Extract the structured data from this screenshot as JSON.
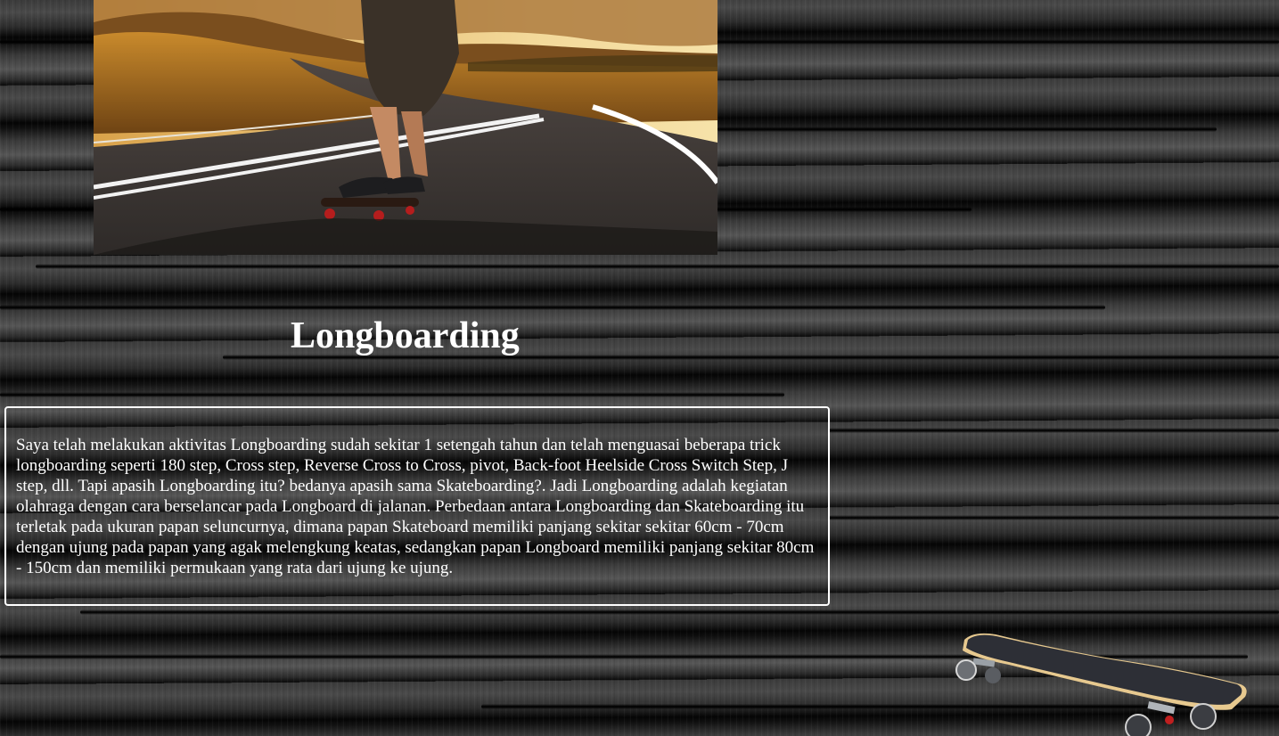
{
  "hero": {
    "icon": "longboarder-road-photo"
  },
  "article": {
    "title": "Longboarding",
    "body": "Saya telah melakukan aktivitas Longboarding sudah sekitar 1 setengah tahun dan telah menguasai beberapa trick longboarding seperti 180 step, Cross step, Reverse Cross to Cross, pivot, Back-foot Heelside Cross Switch Step, J step, dll. Tapi apasih Longboarding itu? bedanya apasih sama Skateboarding?. Jadi Longboarding adalah kegiatan olahraga dengan cara berselancar pada Longboard di jalanan. Perbedaan antara Longboarding dan Skateboarding itu terletak pada ukuran papan seluncurnya, dimana papan Skateboard memiliki panjang sekitar sekitar 60cm - 70cm dengan ujung pada papan yang agak melengkung keatas, sedangkan papan Longboard memiliki panjang sekitar 80cm - 150cm dan memiliki permukaan yang rata dari ujung ke ujung."
  },
  "decor": {
    "skateboard_icon": "longboard-deck-icon"
  },
  "colors": {
    "text": "#ffffff",
    "box_border": "#ffffff",
    "background": "#2a2a2a"
  }
}
